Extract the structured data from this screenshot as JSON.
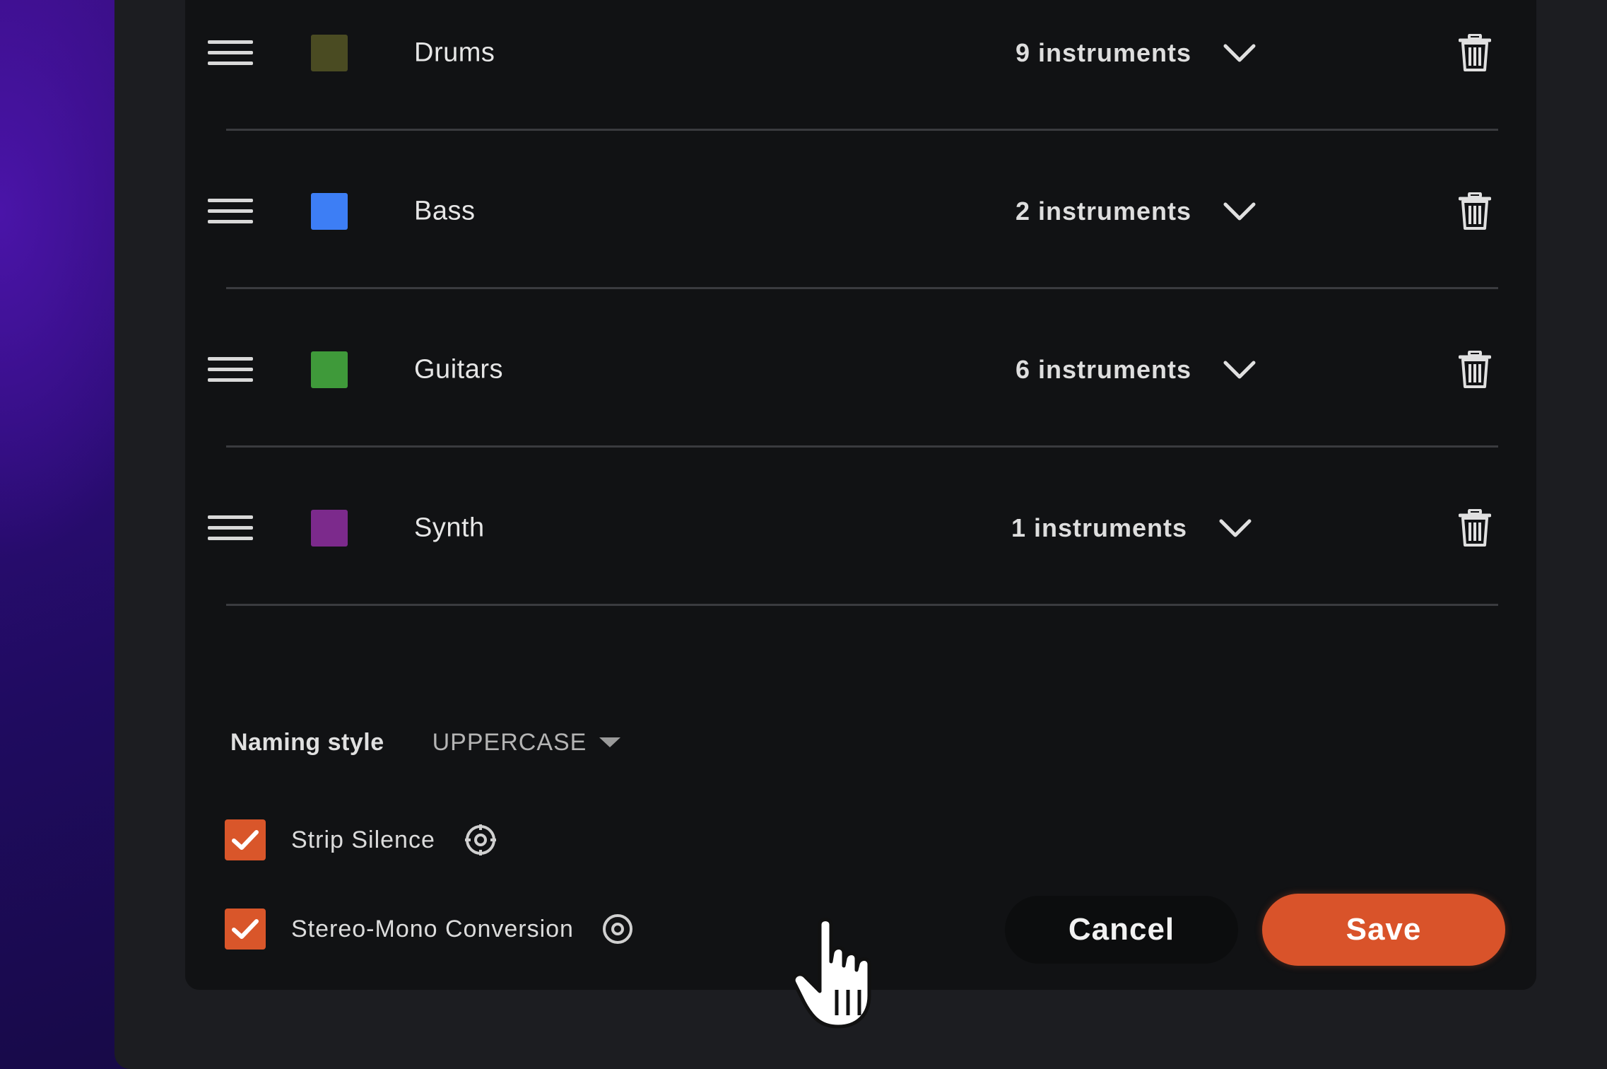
{
  "groups": [
    {
      "name": "Drums",
      "count": "9 instruments",
      "color": "#4a4b22"
    },
    {
      "name": "Bass",
      "count": "2 instruments",
      "color": "#3d7ef5"
    },
    {
      "name": "Guitars",
      "count": "6 instruments",
      "color": "#3f9a3a"
    },
    {
      "name": "Synth",
      "count": "1 instruments",
      "color": "#7c2a8c"
    }
  ],
  "naming": {
    "label": "Naming style",
    "value": "UPPERCASE"
  },
  "options": {
    "strip_silence": {
      "label": "Strip Silence",
      "checked": true
    },
    "stereo_mono": {
      "label": "Stereo-Mono Conversion",
      "checked": true
    }
  },
  "actions": {
    "cancel_label": "Cancel",
    "save_label": "Save"
  },
  "colors": {
    "accent": "#d9532a",
    "panel": "#111214",
    "window": "#1c1d21"
  },
  "icons": {
    "drag": "drag-handle-icon",
    "chevron": "chevron-down-icon",
    "trash": "trash-icon",
    "gear": "gear-icon",
    "check": "check-icon",
    "cursor": "hand-pointer-icon"
  }
}
